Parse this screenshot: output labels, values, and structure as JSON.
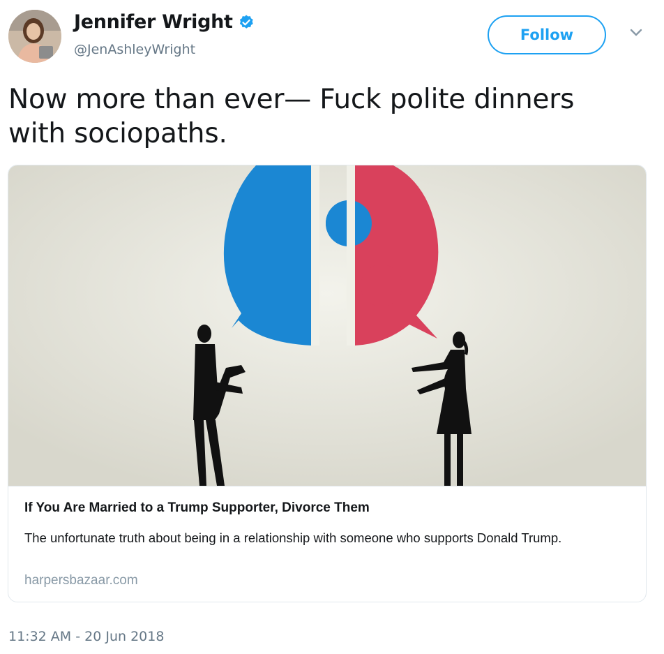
{
  "user": {
    "name": "Jennifer Wright",
    "handle": "@JenAshleyWright",
    "verified": true
  },
  "follow_label": "Follow",
  "tweet": {
    "text_line1": "Now more than ever— Fuck polite dinners",
    "text_line2": "with sociopaths."
  },
  "link_card": {
    "title": "If You Are Married to a Trump Supporter, Divorce Them",
    "description": "The unfortunate truth about being in a relationship with someone who supports Donald Trump.",
    "domain": "harpersbazaar.com"
  },
  "timestamp": "11:32 AM - 20 Jun 2018",
  "colors": {
    "accent": "#1da1f2",
    "bubble_blue": "#1b87d3",
    "bubble_red": "#d9415c",
    "silhouette": "#111111"
  }
}
